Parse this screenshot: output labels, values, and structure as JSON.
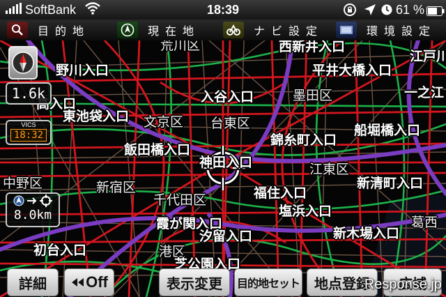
{
  "status_bar": {
    "carrier": "SoftBank",
    "time": "18:39",
    "battery": "61 %"
  },
  "top_menu": [
    {
      "label": "目的地",
      "icon": "search-icon"
    },
    {
      "label": "現在地",
      "icon": "current-location-icon"
    },
    {
      "label": "ナビ設定",
      "icon": "navi-settings-icon"
    },
    {
      "label": "環境設定",
      "icon": "environment-settings-icon"
    }
  ],
  "map": {
    "places": [
      {
        "id": "nishiarai",
        "label": "西新井入口"
      },
      {
        "id": "edogawa",
        "label": "江戸川"
      },
      {
        "id": "arakawa",
        "label": "荒川区"
      },
      {
        "id": "itabashi",
        "label": "野川入口"
      },
      {
        "id": "hirai",
        "label": "平井大橋入口"
      },
      {
        "id": "takashima",
        "label": "高入口"
      },
      {
        "id": "iriya",
        "label": "入谷入口"
      },
      {
        "id": "sumida",
        "label": "墨田区"
      },
      {
        "id": "ichinoe",
        "label": "一之江"
      },
      {
        "id": "higashiike",
        "label": "東池袋入口"
      },
      {
        "id": "bunkyo",
        "label": "文京区"
      },
      {
        "id": "taito",
        "label": "台東区"
      },
      {
        "id": "funabori",
        "label": "船堀橋入口"
      },
      {
        "id": "kinshi",
        "label": "錦糸町入口"
      },
      {
        "id": "iidabashi",
        "label": "飯田橋入口"
      },
      {
        "id": "kanda",
        "label": "神田入口"
      },
      {
        "id": "koto",
        "label": "江東区"
      },
      {
        "id": "nakano",
        "label": "中野区"
      },
      {
        "id": "shinjuku",
        "label": "新宿区"
      },
      {
        "id": "shinkiba_ent",
        "label": "新清町入口"
      },
      {
        "id": "chiyoda",
        "label": "千代田区"
      },
      {
        "id": "fukuzumi",
        "label": "福住入口"
      },
      {
        "id": "shiohama",
        "label": "塩浜入口"
      },
      {
        "id": "kasumi",
        "label": "霞が関入口"
      },
      {
        "id": "shiodome",
        "label": "汐留入口"
      },
      {
        "id": "shinkiba",
        "label": "新木場入口"
      },
      {
        "id": "kasai",
        "label": "葛西"
      },
      {
        "id": "hatsudai",
        "label": "初台入口"
      },
      {
        "id": "minato",
        "label": "港区"
      },
      {
        "id": "shibakoen",
        "label": "芝公園入口"
      }
    ]
  },
  "compass": {
    "icon": "compass-icon"
  },
  "scale_display": {
    "value": "1.6k"
  },
  "vics": {
    "label": "VICS",
    "time": "18:32"
  },
  "distance_display": {
    "value": "8.0km"
  },
  "bottom_buttons": [
    {
      "id": "detail",
      "label": "詳細"
    },
    {
      "id": "voice_off",
      "label": "Off"
    },
    {
      "id": "display_change",
      "label": "表示変更"
    },
    {
      "id": "set_destination",
      "label": "目的地セット"
    },
    {
      "id": "register_point",
      "label": "地点登録"
    },
    {
      "id": "wide_area",
      "label": "広域"
    }
  ],
  "watermark": "Response.jp",
  "colors": {
    "road_red": "#d4161e",
    "road_green": "#1db34a",
    "expressway_purple": "#7a3cc0",
    "minor_road": "#8a6a55",
    "lcd_orange": "#ff9a1a"
  }
}
